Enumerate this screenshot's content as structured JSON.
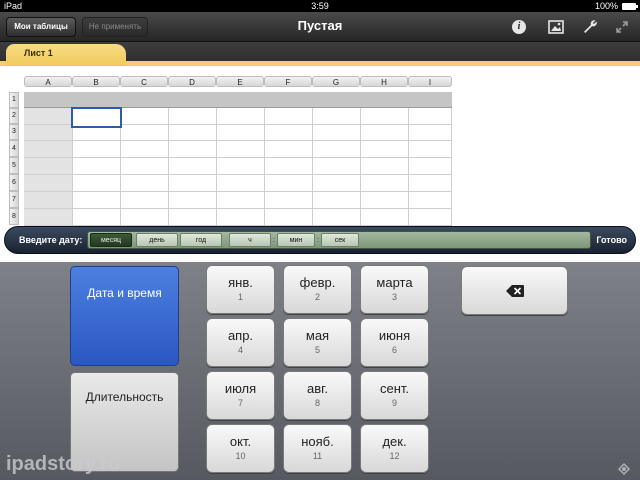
{
  "status_bar": {
    "device": "iPad",
    "time": "3:59",
    "battery": "100%"
  },
  "toolbar": {
    "spreadsheets_button": "Мои таблицы",
    "undo_button": "Не применять",
    "title": "Пустая",
    "icons": [
      "info-icon",
      "media-icon",
      "tools-icon",
      "fullscreen-icon"
    ]
  },
  "sheet_tabs": [
    {
      "label": "Лист 1"
    }
  ],
  "sheet": {
    "columns": [
      "A",
      "B",
      "C",
      "D",
      "E",
      "F",
      "G",
      "H",
      "I"
    ],
    "rows": [
      "1",
      "2",
      "3",
      "4",
      "5",
      "6",
      "7",
      "8"
    ]
  },
  "date_entry": {
    "label": "Введите дату:",
    "fields": [
      {
        "label": "месяц"
      },
      {
        "label": "день"
      },
      {
        "label": "год"
      },
      {
        "label": "ч"
      },
      {
        "label": "мин"
      },
      {
        "label": "сек"
      }
    ],
    "active_field": "месяц",
    "done_button": "Готово"
  },
  "keyboard": {
    "mode_buttons": [
      {
        "label": "Дата и время",
        "selected": true
      },
      {
        "label": "Длительность",
        "selected": false
      }
    ],
    "months": [
      {
        "name": "янв.",
        "number": "1"
      },
      {
        "name": "февр.",
        "number": "2"
      },
      {
        "name": "марта",
        "number": "3"
      },
      {
        "name": "апр.",
        "number": "4"
      },
      {
        "name": "мая",
        "number": "5"
      },
      {
        "name": "июня",
        "number": "6"
      },
      {
        "name": "июля",
        "number": "7"
      },
      {
        "name": "авг.",
        "number": "8"
      },
      {
        "name": "сент.",
        "number": "9"
      },
      {
        "name": "окт.",
        "number": "10"
      },
      {
        "name": "нояб.",
        "number": "11"
      },
      {
        "name": "дек.",
        "number": "12"
      }
    ],
    "delete_key": "delete-icon"
  },
  "watermark": "ipadstory.ru",
  "colors": {
    "toolbar": "#2c2c2c",
    "tab_yellow": "#f0c95a",
    "selected_mode": "#2a58c2",
    "active_token": "#2e4629",
    "selection_border": "#2d5cae"
  }
}
